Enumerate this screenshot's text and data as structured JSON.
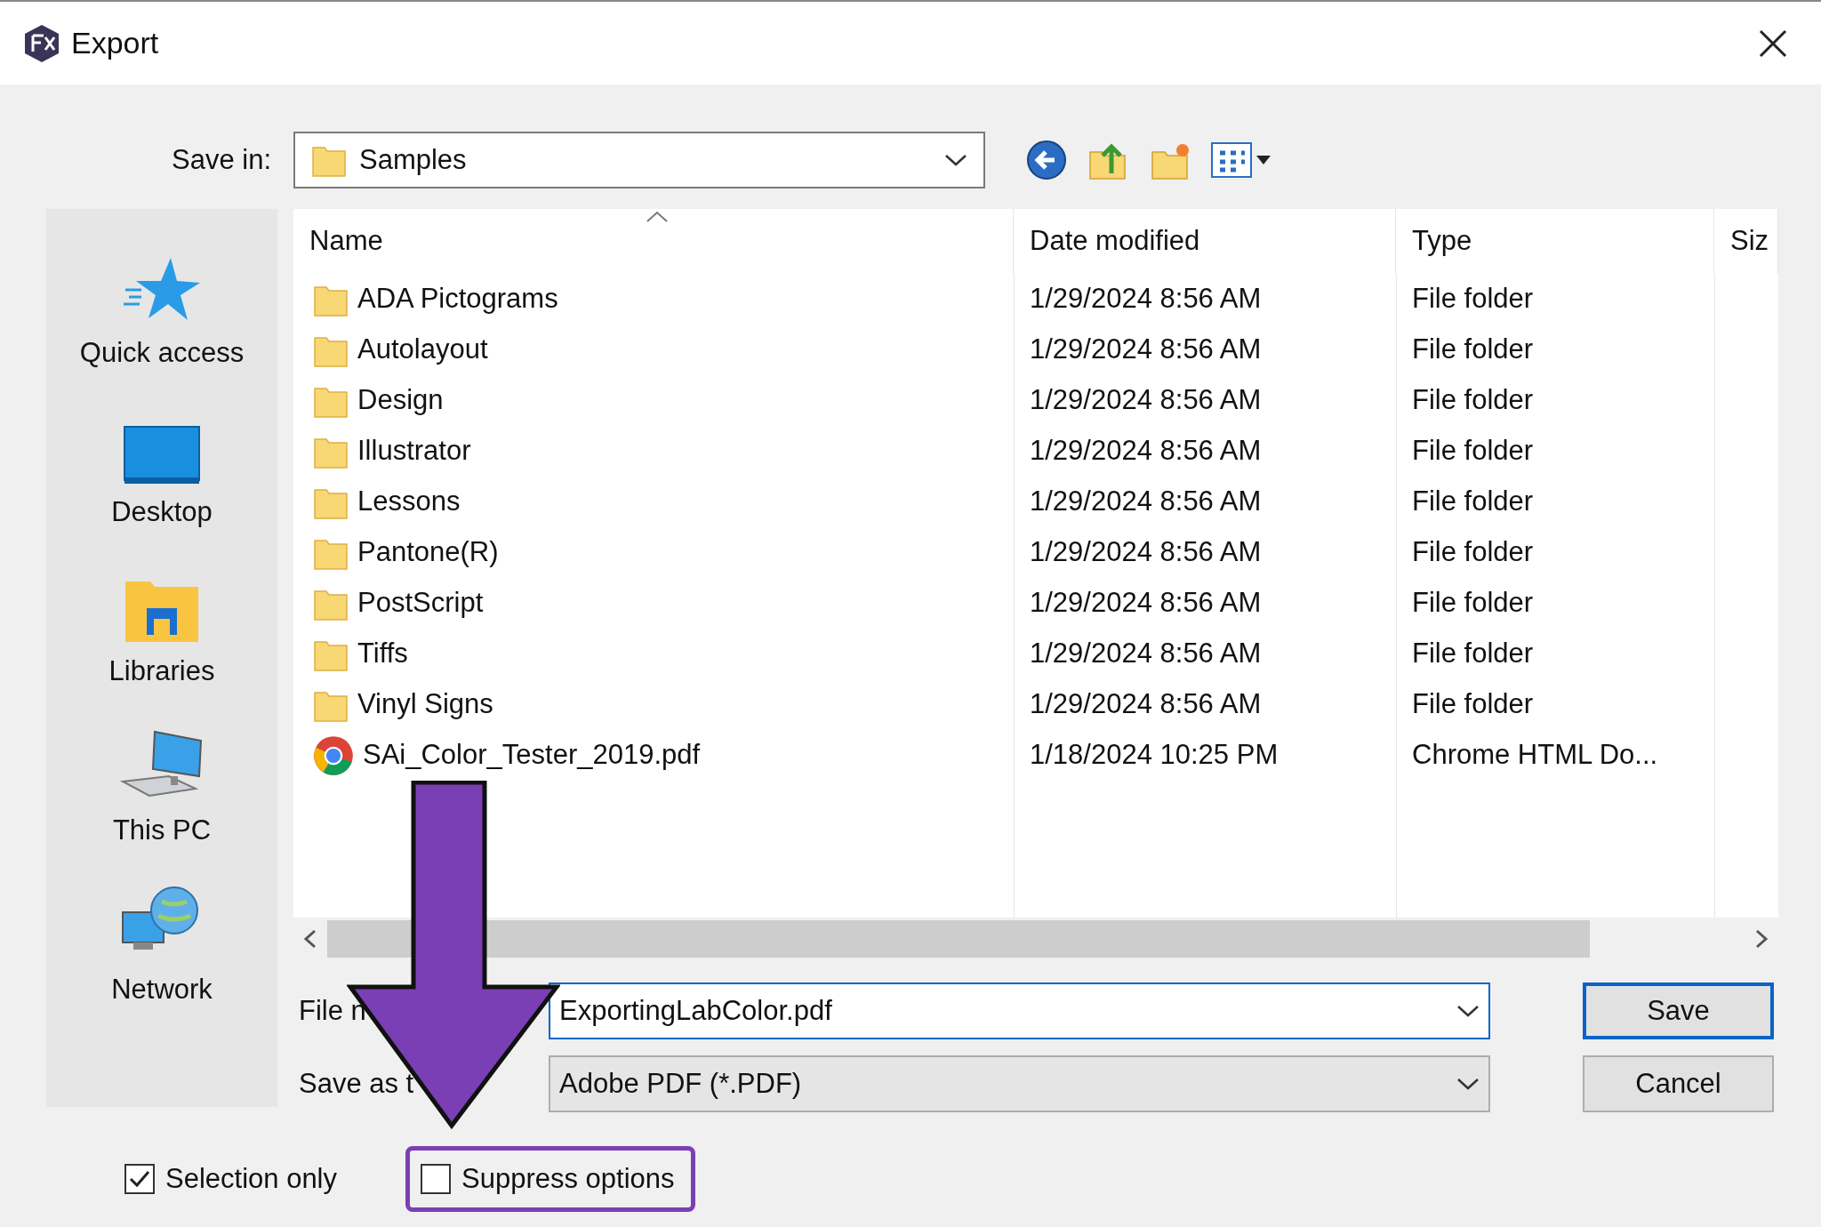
{
  "window": {
    "title": "Export"
  },
  "save_in": {
    "label": "Save in:",
    "value": "Samples"
  },
  "places": [
    {
      "label": "Quick access",
      "kind": "star"
    },
    {
      "label": "Desktop",
      "kind": "desktop"
    },
    {
      "label": "Libraries",
      "kind": "libraries"
    },
    {
      "label": "This PC",
      "kind": "pc"
    },
    {
      "label": "Network",
      "kind": "network"
    }
  ],
  "file_list": {
    "columns": [
      "Name",
      "Date modified",
      "Type",
      "Siz"
    ],
    "rows": [
      {
        "name": "ADA Pictograms",
        "date": "1/29/2024 8:56 AM",
        "type": "File folder",
        "kind": "folder"
      },
      {
        "name": "Autolayout",
        "date": "1/29/2024 8:56 AM",
        "type": "File folder",
        "kind": "folder"
      },
      {
        "name": "Design",
        "date": "1/29/2024 8:56 AM",
        "type": "File folder",
        "kind": "folder"
      },
      {
        "name": "Illustrator",
        "date": "1/29/2024 8:56 AM",
        "type": "File folder",
        "kind": "folder"
      },
      {
        "name": "Lessons",
        "date": "1/29/2024 8:56 AM",
        "type": "File folder",
        "kind": "folder"
      },
      {
        "name": "Pantone(R)",
        "date": "1/29/2024 8:56 AM",
        "type": "File folder",
        "kind": "folder"
      },
      {
        "name": "PostScript",
        "date": "1/29/2024 8:56 AM",
        "type": "File folder",
        "kind": "folder"
      },
      {
        "name": "Tiffs",
        "date": "1/29/2024 8:56 AM",
        "type": "File folder",
        "kind": "folder"
      },
      {
        "name": "Vinyl Signs",
        "date": "1/29/2024 8:56 AM",
        "type": "File folder",
        "kind": "folder"
      },
      {
        "name": "SAi_Color_Tester_2019.pdf",
        "date": "1/18/2024 10:25 PM",
        "type": "Chrome HTML Do...",
        "kind": "pdf"
      }
    ]
  },
  "file_name": {
    "label": "File n",
    "value": "ExportingLabColor.pdf"
  },
  "save_as_type": {
    "label": "Save as t",
    "value": "Adobe PDF (*.PDF)"
  },
  "buttons": [
    {
      "label": "Save",
      "default": true
    },
    {
      "label": "Cancel",
      "default": false
    }
  ],
  "options": [
    {
      "label": "Selection only",
      "checked": true,
      "highlighted": false
    },
    {
      "label": "Suppress options",
      "checked": false,
      "highlighted": true
    }
  ]
}
